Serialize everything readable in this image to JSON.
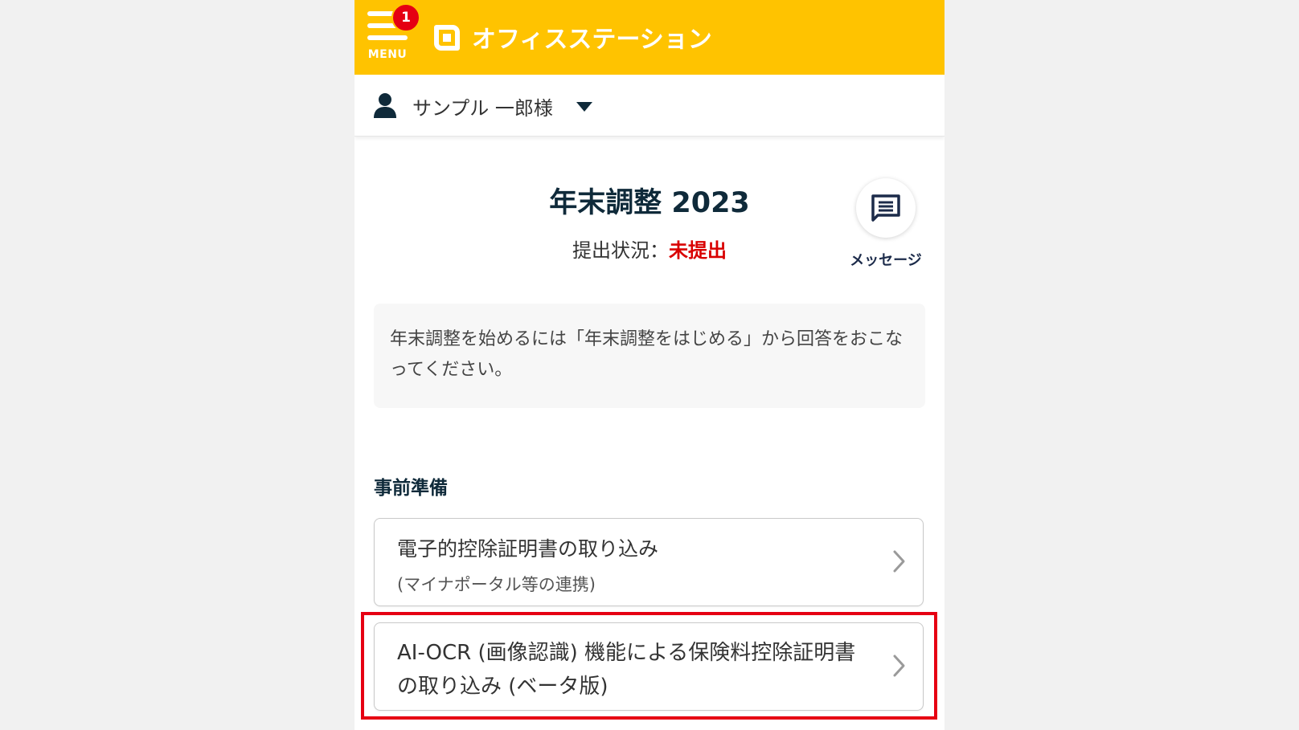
{
  "header": {
    "menu_label": "MENU",
    "notification_count": "1",
    "logo_text": "オフィスステーション",
    "brand_color": "#ffc300"
  },
  "user": {
    "name": "サンプル 一郎様"
  },
  "main": {
    "title": "年末調整 2023",
    "status_label": "提出状況：",
    "status_value": "未提出",
    "message_label": "メッセージ",
    "info_text": "年末調整を始めるには「年末調整をはじめる」から回答をおこなってください。"
  },
  "section": {
    "title": "事前準備",
    "items": [
      {
        "title": "電子的控除証明書の取り込み",
        "subtitle": "(マイナポータル等の連携)"
      },
      {
        "title": "AI-OCR (画像認識) 機能による保険料控除証明書の取り込み (ベータ版)"
      }
    ]
  },
  "colors": {
    "status_red": "#d90000",
    "highlight_red": "#e60012"
  }
}
